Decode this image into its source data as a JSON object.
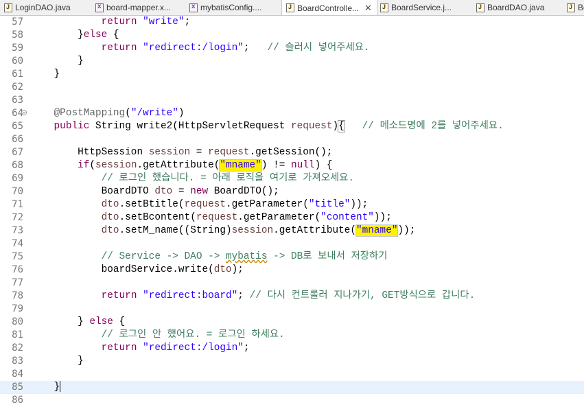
{
  "tabs": [
    {
      "label": "LoginDAO.java",
      "icon": "java-file-icon",
      "active": false
    },
    {
      "label": "board-mapper.x...",
      "icon": "xml-file-icon",
      "active": false
    },
    {
      "label": "mybatisConfig....",
      "icon": "xml-file-icon",
      "active": false
    },
    {
      "label": "BoardControlle...",
      "icon": "java-file-icon",
      "active": true,
      "close": "✕"
    },
    {
      "label": "BoardService.j...",
      "icon": "java-file-icon",
      "active": false
    },
    {
      "label": "BoardDAO.java",
      "icon": "java-file-icon",
      "active": false
    },
    {
      "label": "Bo",
      "icon": "java-file-icon",
      "active": false
    }
  ],
  "current_line": 85,
  "lines": [
    {
      "n": "57",
      "tokens": [
        [
          "            ",
          ""
        ],
        [
          "return",
          "kw"
        ],
        [
          " ",
          ""
        ],
        [
          "\"write\"",
          "str"
        ],
        [
          ";",
          ""
        ]
      ]
    },
    {
      "n": "58",
      "tokens": [
        [
          "        }",
          ""
        ],
        [
          "else",
          "kw"
        ],
        [
          " {",
          ""
        ]
      ]
    },
    {
      "n": "59",
      "tokens": [
        [
          "            ",
          ""
        ],
        [
          "return",
          "kw"
        ],
        [
          " ",
          ""
        ],
        [
          "\"redirect:/login\"",
          "str"
        ],
        [
          ";   ",
          ""
        ],
        [
          "// 슬러시 넣어주세요.",
          "cm"
        ]
      ]
    },
    {
      "n": "60",
      "tokens": [
        [
          "        }",
          ""
        ]
      ]
    },
    {
      "n": "61",
      "tokens": [
        [
          "    }",
          ""
        ]
      ]
    },
    {
      "n": "62",
      "tokens": []
    },
    {
      "n": "63",
      "tokens": []
    },
    {
      "n": "64",
      "fold": true,
      "tokens": [
        [
          "    ",
          ""
        ],
        [
          "@PostMapping",
          "ann"
        ],
        [
          "(",
          ""
        ],
        [
          "\"/write\"",
          "str"
        ],
        [
          ")",
          ""
        ]
      ]
    },
    {
      "n": "65",
      "tokens": [
        [
          "    ",
          ""
        ],
        [
          "public",
          "kw"
        ],
        [
          " String write2(HttpServletRequest ",
          ""
        ],
        [
          "request",
          "var"
        ],
        [
          ")",
          ""
        ],
        [
          "{",
          "bracebox"
        ],
        [
          "   ",
          ""
        ],
        [
          "// 메소드명에 2를 넣어주세요.",
          "cm"
        ]
      ]
    },
    {
      "n": "66",
      "tokens": []
    },
    {
      "n": "67",
      "tokens": [
        [
          "        HttpSession ",
          ""
        ],
        [
          "session",
          "var"
        ],
        [
          " = ",
          ""
        ],
        [
          "request",
          "var"
        ],
        [
          ".getSession();",
          ""
        ]
      ]
    },
    {
      "n": "68",
      "tokens": [
        [
          "        ",
          ""
        ],
        [
          "if",
          "kw"
        ],
        [
          "(",
          ""
        ],
        [
          "session",
          "var"
        ],
        [
          ".getAttribute(",
          ""
        ],
        [
          "\"mname\"",
          "str hl"
        ],
        [
          ") != ",
          ""
        ],
        [
          "null",
          "kw"
        ],
        [
          ") {",
          ""
        ]
      ]
    },
    {
      "n": "69",
      "tokens": [
        [
          "            ",
          ""
        ],
        [
          "// 로그인 했습니다. = 아래 로직을 여기로 가져오세요.",
          "cm"
        ]
      ]
    },
    {
      "n": "70",
      "tokens": [
        [
          "            BoardDTO ",
          ""
        ],
        [
          "dto",
          "var"
        ],
        [
          " = ",
          ""
        ],
        [
          "new",
          "kw"
        ],
        [
          " BoardDTO();",
          ""
        ]
      ]
    },
    {
      "n": "71",
      "tokens": [
        [
          "            ",
          ""
        ],
        [
          "dto",
          "var"
        ],
        [
          ".setBtitle(",
          ""
        ],
        [
          "request",
          "var"
        ],
        [
          ".getParameter(",
          ""
        ],
        [
          "\"title\"",
          "str"
        ],
        [
          "));",
          ""
        ]
      ]
    },
    {
      "n": "72",
      "tokens": [
        [
          "            ",
          ""
        ],
        [
          "dto",
          "var"
        ],
        [
          ".setBcontent(",
          ""
        ],
        [
          "request",
          "var"
        ],
        [
          ".getParameter(",
          ""
        ],
        [
          "\"content\"",
          "str"
        ],
        [
          "));",
          ""
        ]
      ]
    },
    {
      "n": "73",
      "tokens": [
        [
          "            ",
          ""
        ],
        [
          "dto",
          "var"
        ],
        [
          ".setM_name((String)",
          ""
        ],
        [
          "session",
          "var"
        ],
        [
          ".getAttribute(",
          ""
        ],
        [
          "\"mname\"",
          "str hl"
        ],
        [
          "));",
          ""
        ]
      ]
    },
    {
      "n": "74",
      "tokens": []
    },
    {
      "n": "75",
      "tokens": [
        [
          "            ",
          ""
        ],
        [
          "// Service -> DAO -> ",
          "cm"
        ],
        [
          "mybatis",
          "cm squig"
        ],
        [
          " -> DB로 보내서 저장하기",
          "cm"
        ]
      ]
    },
    {
      "n": "76",
      "tokens": [
        [
          "            boardService.write(",
          ""
        ],
        [
          "dto",
          "var"
        ],
        [
          ");",
          ""
        ]
      ]
    },
    {
      "n": "77",
      "tokens": []
    },
    {
      "n": "78",
      "tokens": [
        [
          "            ",
          ""
        ],
        [
          "return",
          "kw"
        ],
        [
          " ",
          ""
        ],
        [
          "\"redirect:board\"",
          "str"
        ],
        [
          "; ",
          ""
        ],
        [
          "// 다시 컨트롤러 지나가기, GET방식으로 갑니다.",
          "cm"
        ]
      ]
    },
    {
      "n": "79",
      "tokens": []
    },
    {
      "n": "80",
      "tokens": [
        [
          "        } ",
          ""
        ],
        [
          "else",
          "kw"
        ],
        [
          " {",
          ""
        ]
      ]
    },
    {
      "n": "81",
      "tokens": [
        [
          "            ",
          ""
        ],
        [
          "// 로그인 안 했어요. = 로그인 하세요.",
          "cm"
        ]
      ]
    },
    {
      "n": "82",
      "tokens": [
        [
          "            ",
          ""
        ],
        [
          "return",
          "kw"
        ],
        [
          " ",
          ""
        ],
        [
          "\"redirect:/login\"",
          "str"
        ],
        [
          ";",
          ""
        ]
      ]
    },
    {
      "n": "83",
      "tokens": [
        [
          "        }",
          ""
        ]
      ]
    },
    {
      "n": "84",
      "tokens": []
    },
    {
      "n": "85",
      "caret": true,
      "tokens": [
        [
          "    }",
          ""
        ]
      ]
    },
    {
      "n": "86",
      "tokens": []
    }
  ]
}
